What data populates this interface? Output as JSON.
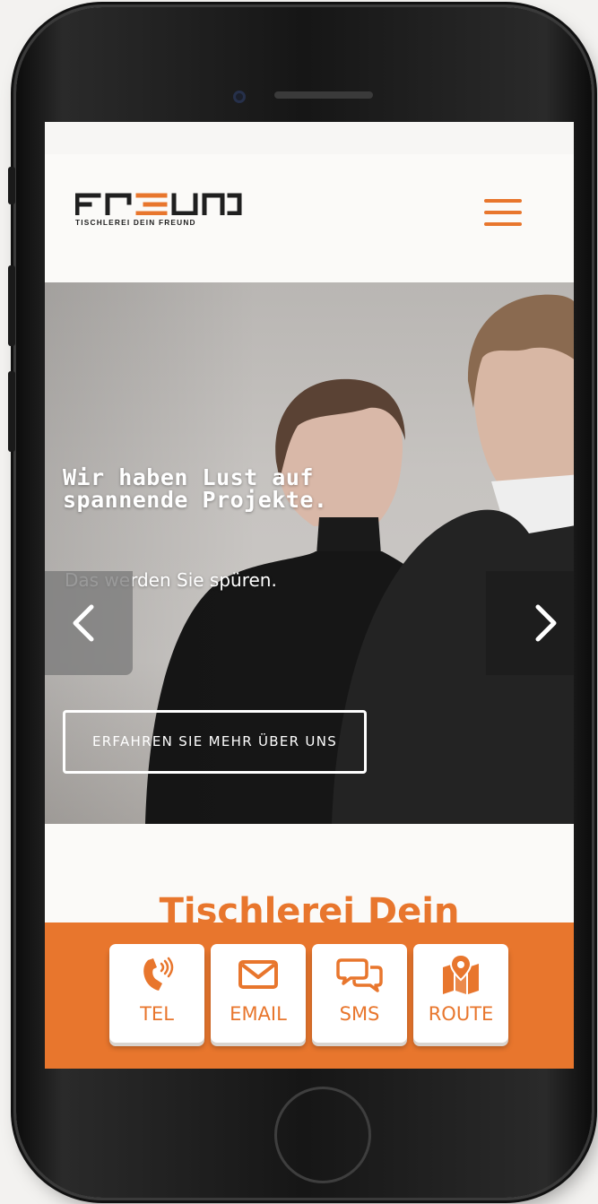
{
  "site": {
    "logo_wordmark": "FREUND",
    "logo_tagline": "TISCHLEREI DEIN FREUND",
    "menu_icon": "hamburger-menu-icon"
  },
  "hero": {
    "title": "Wir haben Lust auf spannende Projekte.",
    "subtitle": "Das werden Sie spüren.",
    "cta_label": "ERFAHREN SIE MEHR ÜBER UNS",
    "prev_icon": "chevron-left-icon",
    "next_icon": "chevron-right-icon"
  },
  "section": {
    "title": "Tischlerei Dein"
  },
  "actions": [
    {
      "label": "TEL",
      "icon": "phone-icon"
    },
    {
      "label": "EMAIL",
      "icon": "envelope-icon"
    },
    {
      "label": "SMS",
      "icon": "chat-bubbles-icon"
    },
    {
      "label": "ROUTE",
      "icon": "map-pin-icon"
    }
  ],
  "colors": {
    "accent": "#e8762d",
    "white": "#ffffff",
    "dark": "#1f1f1f"
  }
}
